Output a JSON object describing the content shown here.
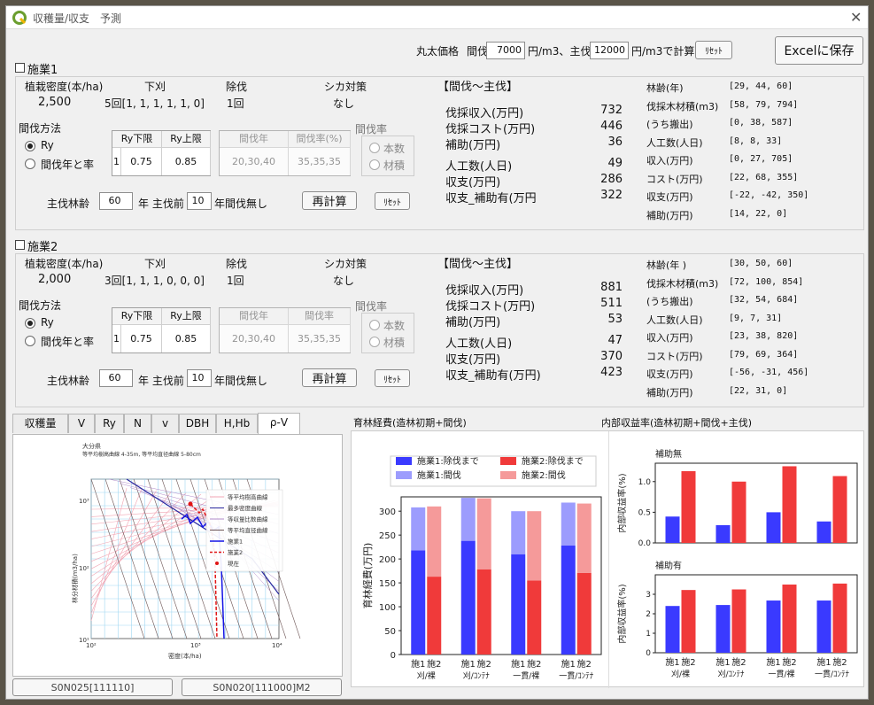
{
  "window": {
    "title": "収穫量/収支　予測"
  },
  "price": {
    "label": "丸太価格",
    "thin_label": "間伐",
    "thin_value": "7000",
    "thin_unit": "円/m3、主伐",
    "main_value": "12000",
    "main_unit": "円/m3で計算",
    "reset": "ﾘｾｯﾄ",
    "excel": "Excelに保存"
  },
  "op1": {
    "title": "施業1",
    "density_header": "植栽密度(本/ha)",
    "weeding_header": "下刈",
    "thinning_header": "除伐",
    "deer_header": "シカ対策",
    "density": "2,500",
    "weeding": "5回[1, 1, 1, 1, 1, 0]",
    "cleaning": "1回",
    "deer": "なし",
    "method_label": "間伐方法",
    "radio_ry": "Ry",
    "radio_year": "間伐年と率",
    "grid_left": {
      "h1": "Ry下限",
      "h2": "Ry上限",
      "idx": "1",
      "v1": "0.75",
      "v2": "0.85"
    },
    "grid_right": {
      "h1": "間伐年",
      "h2": "間伐率(%)",
      "v1": "20,30,40",
      "v2": "35,35,35"
    },
    "rate_label": "間伐率",
    "rate_opt1": "本数",
    "rate_opt2": "材積",
    "main_age_label": "主伐林齢",
    "main_age": "60",
    "year_label": "年 主伐前",
    "before": "10",
    "none_label": "年間伐無し",
    "recalc": "再計算",
    "reset": "ﾘｾｯﾄ",
    "summary_title": "【間伐～主伐】",
    "summary": [
      {
        "label": "伐採収入(万円)",
        "value": "732"
      },
      {
        "label": "伐採コスト(万円)",
        "value": "446"
      },
      {
        "label": "補助(万円)",
        "value": "36"
      },
      {
        "label": "人工数(人日)",
        "value": "49"
      },
      {
        "label": "収支(万円)",
        "value": "286"
      },
      {
        "label": "収支_補助有(万円",
        "value": "322"
      }
    ],
    "detail": [
      {
        "label": "林齢(年)",
        "value": "[29, 44, 60]"
      },
      {
        "label": "伐採木材積(m3)",
        "value": "[58, 79, 794]"
      },
      {
        "label": "(うち搬出)",
        "value": "[0, 38, 587]"
      },
      {
        "label": "人工数(人日)",
        "value": "[8, 8, 33]"
      },
      {
        "label": "収入(万円)",
        "value": "[0, 27, 705]"
      },
      {
        "label": "コスト(万円)",
        "value": "[22, 68, 355]"
      },
      {
        "label": "収支(万円)",
        "value": "[-22, -42, 350]"
      },
      {
        "label": "補助(万円)",
        "value": "[14, 22, 0]"
      }
    ]
  },
  "op2": {
    "title": "施業2",
    "density_header": "植栽密度(本/ha)",
    "weeding_header": "下刈",
    "thinning_header": "除伐",
    "deer_header": "シカ対策",
    "density": "2,000",
    "weeding": "3回[1, 1, 1, 0, 0, 0]",
    "cleaning": "1回",
    "deer": "なし",
    "method_label": "間伐方法",
    "radio_ry": "Ry",
    "radio_year": "間伐年と率",
    "grid_left": {
      "h1": "Ry下限",
      "h2": "Ry上限",
      "idx": "1",
      "v1": "0.75",
      "v2": "0.85"
    },
    "grid_right": {
      "h1": "間伐年",
      "h2": "間伐率",
      "v1": "20,30,40",
      "v2": "35,35,35"
    },
    "rate_label": "間伐率",
    "rate_opt1": "本数",
    "rate_opt2": "材積",
    "main_age_label": "主伐林齢",
    "main_age": "60",
    "year_label": "年 主伐前",
    "before": "10",
    "none_label": "年間伐無し",
    "recalc": "再計算",
    "reset": "ﾘｾｯﾄ",
    "summary_title": "【間伐～主伐】",
    "summary": [
      {
        "label": "伐採収入(万円)",
        "value": "881"
      },
      {
        "label": "伐採コスト(万円)",
        "value": "511"
      },
      {
        "label": "補助(万円)",
        "value": "53"
      },
      {
        "label": "人工数(人日)",
        "value": "47"
      },
      {
        "label": "収支(万円)",
        "value": "370"
      },
      {
        "label": "収支_補助有(万円)",
        "value": "423"
      }
    ],
    "detail": [
      {
        "label": "林齢(年 )",
        "value": "[30, 50, 60]"
      },
      {
        "label": "伐採木材積(m3)",
        "value": "[72, 100, 854]"
      },
      {
        "label": "(うち搬出)",
        "value": "[32, 54, 684]"
      },
      {
        "label": "人工数(人日)",
        "value": "[9, 7, 31]"
      },
      {
        "label": "収入(万円)",
        "value": "[23, 38, 820]"
      },
      {
        "label": "コスト(万円)",
        "value": "[79, 69, 364]"
      },
      {
        "label": "収支(万円)",
        "value": "[-56, -31, 456]"
      },
      {
        "label": "補助(万円)",
        "value": "[22, 31, 0]"
      }
    ]
  },
  "tabs": [
    "収穫量",
    "V",
    "Ry",
    "N",
    "v",
    "DBH",
    "H,Hb",
    "ρ-V"
  ],
  "diagram": {
    "region": "大分県",
    "line1": "等平均樹高曲線 4-35m, 等平均直径曲線 5-80cm",
    "xlabel": "密度(本/ha)",
    "ylabel": "林分材積(m3/ha)",
    "legend": [
      "等平均樹高曲線",
      "最多密度曲線",
      "等収量比数曲線",
      "等平均直径曲線",
      "施業1",
      "施業2",
      "現在"
    ],
    "yt": [
      "10³",
      "10²",
      "10¹"
    ],
    "xt": [
      "10²",
      "10³",
      "10⁴"
    ]
  },
  "bottom_buttons": [
    "S0N025[111110]",
    "S0N020[111000]M2"
  ],
  "colors": {
    "blue": "#3a3aff",
    "red": "#f03a3a",
    "light_blue": "#9c9cfd",
    "light_red": "#f59a9a"
  },
  "chart_data": [
    {
      "type": "bar",
      "title": "育林経費(造林初期+間伐)",
      "ylabel": "育林経費(万円)",
      "ylim": [
        0,
        330
      ],
      "yticks": [
        "0",
        "50",
        "100",
        "150",
        "200",
        "250",
        "300"
      ],
      "categories": [
        "刈/裸",
        "刈/ｺﾝﾃﾅ",
        "一貫/裸",
        "一貫/ｺﾝﾃﾅ"
      ],
      "sublabel1": "施1",
      "sublabel2": "施2",
      "series": [
        {
          "name": "施業1:除伐まで",
          "values": [
            218,
            238,
            210,
            228
          ]
        },
        {
          "name": "施業1:間伐",
          "values": [
            90,
            90,
            90,
            90
          ]
        },
        {
          "name": "施業2:除伐まで",
          "values": [
            163,
            178,
            155,
            171
          ]
        },
        {
          "name": "施業2:間伐",
          "values": [
            147,
            149,
            145,
            145
          ]
        }
      ]
    },
    {
      "type": "bar",
      "title": "内部収益率(造林初期+間伐+主伐)",
      "panels": [
        {
          "title": "補助無",
          "ylabel": "内部収益率(%)",
          "yticks": [
            "0.0",
            "0.5",
            "1.0"
          ],
          "ylim": [
            0,
            1.3
          ],
          "series": [
            {
              "name": "施1",
              "values": [
                0.43,
                0.29,
                0.5,
                0.35
              ]
            },
            {
              "name": "施2",
              "values": [
                1.17,
                1.0,
                1.25,
                1.09
              ]
            }
          ]
        },
        {
          "title": "補助有",
          "ylabel": "内部収益率(%)",
          "yticks": [
            "0",
            "1",
            "2",
            "3"
          ],
          "ylim": [
            0,
            4
          ],
          "series": [
            {
              "name": "施1",
              "values": [
                2.4,
                2.45,
                2.68,
                2.68
              ]
            },
            {
              "name": "施2",
              "values": [
                3.22,
                3.25,
                3.5,
                3.55
              ]
            }
          ]
        }
      ],
      "categories": [
        "刈/裸",
        "刈/ｺﾝﾃﾅ",
        "一貫/裸",
        "一貫/ｺﾝﾃﾅ"
      ],
      "sublabel1": "施1",
      "sublabel2": "施2"
    }
  ]
}
